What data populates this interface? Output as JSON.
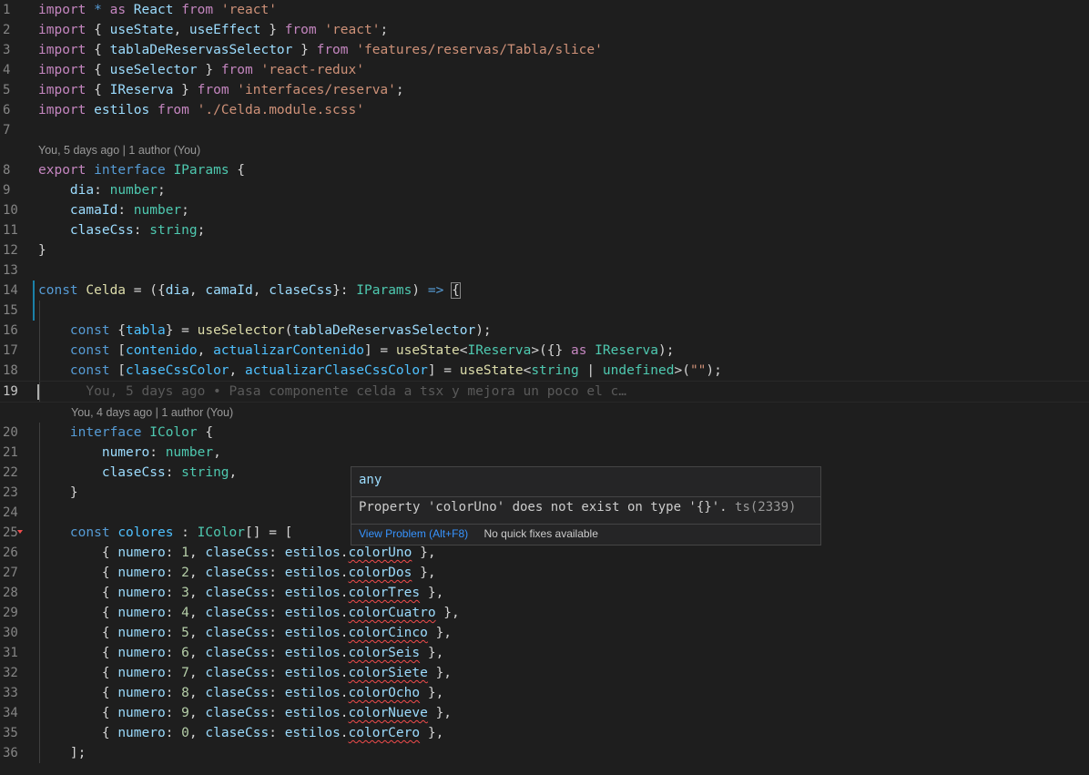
{
  "code_lines": [
    {
      "n": "1",
      "tokens": [
        [
          "kw2",
          "import"
        ],
        [
          "plain",
          " "
        ],
        [
          "kw",
          "*"
        ],
        [
          "plain",
          " "
        ],
        [
          "kw2",
          "as"
        ],
        [
          "plain",
          " "
        ],
        [
          "var",
          "React"
        ],
        [
          "plain",
          " "
        ],
        [
          "kw2",
          "from"
        ],
        [
          "plain",
          " "
        ],
        [
          "str",
          "'react'"
        ]
      ]
    },
    {
      "n": "2",
      "tokens": [
        [
          "kw2",
          "import"
        ],
        [
          "plain",
          " { "
        ],
        [
          "var",
          "useState"
        ],
        [
          "plain",
          ", "
        ],
        [
          "var",
          "useEffect"
        ],
        [
          "plain",
          " } "
        ],
        [
          "kw2",
          "from"
        ],
        [
          "plain",
          " "
        ],
        [
          "str",
          "'react'"
        ],
        [
          "plain",
          ";"
        ]
      ]
    },
    {
      "n": "3",
      "tokens": [
        [
          "kw2",
          "import"
        ],
        [
          "plain",
          " { "
        ],
        [
          "var",
          "tablaDeReservasSelector"
        ],
        [
          "plain",
          " } "
        ],
        [
          "kw2",
          "from"
        ],
        [
          "plain",
          " "
        ],
        [
          "str",
          "'features/reservas/Tabla/slice'"
        ]
      ]
    },
    {
      "n": "4",
      "tokens": [
        [
          "kw2",
          "import"
        ],
        [
          "plain",
          " { "
        ],
        [
          "var",
          "useSelector"
        ],
        [
          "plain",
          " } "
        ],
        [
          "kw2",
          "from"
        ],
        [
          "plain",
          " "
        ],
        [
          "str",
          "'react-redux'"
        ]
      ]
    },
    {
      "n": "5",
      "tokens": [
        [
          "kw2",
          "import"
        ],
        [
          "plain",
          " { "
        ],
        [
          "var",
          "IReserva"
        ],
        [
          "plain",
          " } "
        ],
        [
          "kw2",
          "from"
        ],
        [
          "plain",
          " "
        ],
        [
          "str",
          "'interfaces/reserva'"
        ],
        [
          "plain",
          ";"
        ]
      ]
    },
    {
      "n": "6",
      "tokens": [
        [
          "kw2",
          "import"
        ],
        [
          "plain",
          " "
        ],
        [
          "var",
          "estilos"
        ],
        [
          "plain",
          " "
        ],
        [
          "kw2",
          "from"
        ],
        [
          "plain",
          " "
        ],
        [
          "str",
          "'./Celda.module.scss'"
        ]
      ]
    },
    {
      "n": "7",
      "tokens": []
    },
    {
      "lens": "You, 5 days ago | 1 author (You)",
      "indent": false
    },
    {
      "n": "8",
      "tokens": [
        [
          "kw2",
          "export"
        ],
        [
          "plain",
          " "
        ],
        [
          "kw",
          "interface"
        ],
        [
          "plain",
          " "
        ],
        [
          "ty",
          "IParams"
        ],
        [
          "plain",
          " {"
        ]
      ]
    },
    {
      "n": "9",
      "tokens": [
        [
          "plain",
          "    "
        ],
        [
          "var",
          "dia"
        ],
        [
          "plain",
          ": "
        ],
        [
          "ty",
          "number"
        ],
        [
          "plain",
          ";"
        ]
      ]
    },
    {
      "n": "10",
      "tokens": [
        [
          "plain",
          "    "
        ],
        [
          "var",
          "camaId"
        ],
        [
          "plain",
          ": "
        ],
        [
          "ty",
          "number"
        ],
        [
          "plain",
          ";"
        ]
      ]
    },
    {
      "n": "11",
      "tokens": [
        [
          "plain",
          "    "
        ],
        [
          "var",
          "claseCss"
        ],
        [
          "plain",
          ": "
        ],
        [
          "ty",
          "string"
        ],
        [
          "plain",
          ";"
        ]
      ]
    },
    {
      "n": "12",
      "tokens": [
        [
          "plain",
          "}"
        ]
      ]
    },
    {
      "n": "13",
      "tokens": []
    },
    {
      "n": "14",
      "mark": true,
      "tokens": [
        [
          "kw",
          "const"
        ],
        [
          "plain",
          " "
        ],
        [
          "fn",
          "Celda"
        ],
        [
          "plain",
          " = ({"
        ],
        [
          "var",
          "dia"
        ],
        [
          "plain",
          ", "
        ],
        [
          "var",
          "camaId"
        ],
        [
          "plain",
          ", "
        ],
        [
          "var",
          "claseCss"
        ],
        [
          "plain",
          "}: "
        ],
        [
          "ty",
          "IParams"
        ],
        [
          "plain",
          ") "
        ],
        [
          "kw",
          "=>"
        ],
        [
          "plain",
          " "
        ],
        [
          "hl",
          "{"
        ]
      ]
    },
    {
      "n": "15",
      "mark": true,
      "tokens": []
    },
    {
      "n": "16",
      "tokens": [
        [
          "plain",
          "    "
        ],
        [
          "kw",
          "const"
        ],
        [
          "plain",
          " {"
        ],
        [
          "cst",
          "tabla"
        ],
        [
          "plain",
          "} = "
        ],
        [
          "fn",
          "useSelector"
        ],
        [
          "plain",
          "("
        ],
        [
          "var",
          "tablaDeReservasSelector"
        ],
        [
          "plain",
          ");"
        ]
      ]
    },
    {
      "n": "17",
      "tokens": [
        [
          "plain",
          "    "
        ],
        [
          "kw",
          "const"
        ],
        [
          "plain",
          " ["
        ],
        [
          "cst",
          "contenido"
        ],
        [
          "plain",
          ", "
        ],
        [
          "cst",
          "actualizarContenido"
        ],
        [
          "plain",
          "] = "
        ],
        [
          "fn",
          "useState"
        ],
        [
          "plain",
          "<"
        ],
        [
          "ty",
          "IReserva"
        ],
        [
          "plain",
          ">({} "
        ],
        [
          "kw2",
          "as"
        ],
        [
          "plain",
          " "
        ],
        [
          "ty",
          "IReserva"
        ],
        [
          "plain",
          ");"
        ]
      ]
    },
    {
      "n": "18",
      "tokens": [
        [
          "plain",
          "    "
        ],
        [
          "kw",
          "const"
        ],
        [
          "plain",
          " ["
        ],
        [
          "cst",
          "claseCssColor"
        ],
        [
          "plain",
          ", "
        ],
        [
          "cst",
          "actualizarClaseCssColor"
        ],
        [
          "plain",
          "] = "
        ],
        [
          "fn",
          "useState"
        ],
        [
          "plain",
          "<"
        ],
        [
          "ty",
          "string"
        ],
        [
          "plain",
          " | "
        ],
        [
          "ty",
          "undefined"
        ],
        [
          "plain",
          ">("
        ],
        [
          "str",
          "\"\""
        ],
        [
          "plain",
          ");"
        ]
      ]
    },
    {
      "n": "19",
      "active": true,
      "ghost": "You, 5 days ago • Pasa componente celda a tsx y mejora un poco el c…",
      "tokens": []
    },
    {
      "lens": "You, 4 days ago | 1 author (You)",
      "indent": true
    },
    {
      "n": "20",
      "tokens": [
        [
          "plain",
          "    "
        ],
        [
          "kw",
          "interface"
        ],
        [
          "plain",
          " "
        ],
        [
          "ty",
          "IColor"
        ],
        [
          "plain",
          " {"
        ]
      ]
    },
    {
      "n": "21",
      "tokens": [
        [
          "plain",
          "        "
        ],
        [
          "var",
          "numero"
        ],
        [
          "plain",
          ": "
        ],
        [
          "ty",
          "number"
        ],
        [
          "plain",
          ","
        ]
      ]
    },
    {
      "n": "22",
      "tokens": [
        [
          "plain",
          "        "
        ],
        [
          "var",
          "claseCss"
        ],
        [
          "plain",
          ": "
        ],
        [
          "ty",
          "string"
        ],
        [
          "plain",
          ","
        ]
      ]
    },
    {
      "n": "23",
      "tokens": [
        [
          "plain",
          "    }"
        ]
      ]
    },
    {
      "n": "24",
      "tokens": []
    },
    {
      "n": "25",
      "err": true,
      "tokens": [
        [
          "plain",
          "    "
        ],
        [
          "kw",
          "const"
        ],
        [
          "plain",
          " "
        ],
        [
          "cst",
          "colores"
        ],
        [
          "plain",
          " : "
        ],
        [
          "ty",
          "IColor"
        ],
        [
          "plain",
          "[] = ["
        ]
      ]
    },
    {
      "n": "26",
      "tokens": [
        [
          "plain",
          "        { "
        ],
        [
          "var",
          "numero"
        ],
        [
          "plain",
          ": "
        ],
        [
          "num",
          "1"
        ],
        [
          "plain",
          ", "
        ],
        [
          "var",
          "claseCss"
        ],
        [
          "plain",
          ": "
        ],
        [
          "var",
          "estilos"
        ],
        [
          "plain",
          "."
        ],
        [
          "varw",
          "colorUno"
        ],
        [
          "plain",
          " },"
        ]
      ]
    },
    {
      "n": "27",
      "tokens": [
        [
          "plain",
          "        { "
        ],
        [
          "var",
          "numero"
        ],
        [
          "plain",
          ": "
        ],
        [
          "num",
          "2"
        ],
        [
          "plain",
          ", "
        ],
        [
          "var",
          "claseCss"
        ],
        [
          "plain",
          ": "
        ],
        [
          "var",
          "estilos"
        ],
        [
          "plain",
          "."
        ],
        [
          "varw",
          "colorDos"
        ],
        [
          "plain",
          " },"
        ]
      ]
    },
    {
      "n": "28",
      "tokens": [
        [
          "plain",
          "        { "
        ],
        [
          "var",
          "numero"
        ],
        [
          "plain",
          ": "
        ],
        [
          "num",
          "3"
        ],
        [
          "plain",
          ", "
        ],
        [
          "var",
          "claseCss"
        ],
        [
          "plain",
          ": "
        ],
        [
          "var",
          "estilos"
        ],
        [
          "plain",
          "."
        ],
        [
          "varw",
          "colorTres"
        ],
        [
          "plain",
          " },"
        ]
      ]
    },
    {
      "n": "29",
      "tokens": [
        [
          "plain",
          "        { "
        ],
        [
          "var",
          "numero"
        ],
        [
          "plain",
          ": "
        ],
        [
          "num",
          "4"
        ],
        [
          "plain",
          ", "
        ],
        [
          "var",
          "claseCss"
        ],
        [
          "plain",
          ": "
        ],
        [
          "var",
          "estilos"
        ],
        [
          "plain",
          "."
        ],
        [
          "varw",
          "colorCuatro"
        ],
        [
          "plain",
          " },"
        ]
      ]
    },
    {
      "n": "30",
      "tokens": [
        [
          "plain",
          "        { "
        ],
        [
          "var",
          "numero"
        ],
        [
          "plain",
          ": "
        ],
        [
          "num",
          "5"
        ],
        [
          "plain",
          ", "
        ],
        [
          "var",
          "claseCss"
        ],
        [
          "plain",
          ": "
        ],
        [
          "var",
          "estilos"
        ],
        [
          "plain",
          "."
        ],
        [
          "varw",
          "colorCinco"
        ],
        [
          "plain",
          " },"
        ]
      ]
    },
    {
      "n": "31",
      "tokens": [
        [
          "plain",
          "        { "
        ],
        [
          "var",
          "numero"
        ],
        [
          "plain",
          ": "
        ],
        [
          "num",
          "6"
        ],
        [
          "plain",
          ", "
        ],
        [
          "var",
          "claseCss"
        ],
        [
          "plain",
          ": "
        ],
        [
          "var",
          "estilos"
        ],
        [
          "plain",
          "."
        ],
        [
          "varw",
          "colorSeis"
        ],
        [
          "plain",
          " },"
        ]
      ]
    },
    {
      "n": "32",
      "tokens": [
        [
          "plain",
          "        { "
        ],
        [
          "var",
          "numero"
        ],
        [
          "plain",
          ": "
        ],
        [
          "num",
          "7"
        ],
        [
          "plain",
          ", "
        ],
        [
          "var",
          "claseCss"
        ],
        [
          "plain",
          ": "
        ],
        [
          "var",
          "estilos"
        ],
        [
          "plain",
          "."
        ],
        [
          "varw",
          "colorSiete"
        ],
        [
          "plain",
          " },"
        ]
      ]
    },
    {
      "n": "33",
      "tokens": [
        [
          "plain",
          "        { "
        ],
        [
          "var",
          "numero"
        ],
        [
          "plain",
          ": "
        ],
        [
          "num",
          "8"
        ],
        [
          "plain",
          ", "
        ],
        [
          "var",
          "claseCss"
        ],
        [
          "plain",
          ": "
        ],
        [
          "var",
          "estilos"
        ],
        [
          "plain",
          "."
        ],
        [
          "varw",
          "colorOcho"
        ],
        [
          "plain",
          " },"
        ]
      ]
    },
    {
      "n": "34",
      "tokens": [
        [
          "plain",
          "        { "
        ],
        [
          "var",
          "numero"
        ],
        [
          "plain",
          ": "
        ],
        [
          "num",
          "9"
        ],
        [
          "plain",
          ", "
        ],
        [
          "var",
          "claseCss"
        ],
        [
          "plain",
          ": "
        ],
        [
          "var",
          "estilos"
        ],
        [
          "plain",
          "."
        ],
        [
          "varw",
          "colorNueve"
        ],
        [
          "plain",
          " },"
        ]
      ]
    },
    {
      "n": "35",
      "tokens": [
        [
          "plain",
          "        { "
        ],
        [
          "var",
          "numero"
        ],
        [
          "plain",
          ": "
        ],
        [
          "num",
          "0"
        ],
        [
          "plain",
          ", "
        ],
        [
          "var",
          "claseCss"
        ],
        [
          "plain",
          ": "
        ],
        [
          "var",
          "estilos"
        ],
        [
          "plain",
          "."
        ],
        [
          "varw",
          "colorCero"
        ],
        [
          "plain",
          " },"
        ]
      ]
    },
    {
      "n": "36",
      "tokens": [
        [
          "plain",
          "    ];"
        ]
      ]
    }
  ],
  "hover": {
    "signature": "any",
    "message": "Property 'colorUno' does not exist on type '{}'. ",
    "code": "ts(2339)",
    "view_problem": "View Problem (Alt+F8)",
    "no_fixes": "No quick fixes available"
  }
}
